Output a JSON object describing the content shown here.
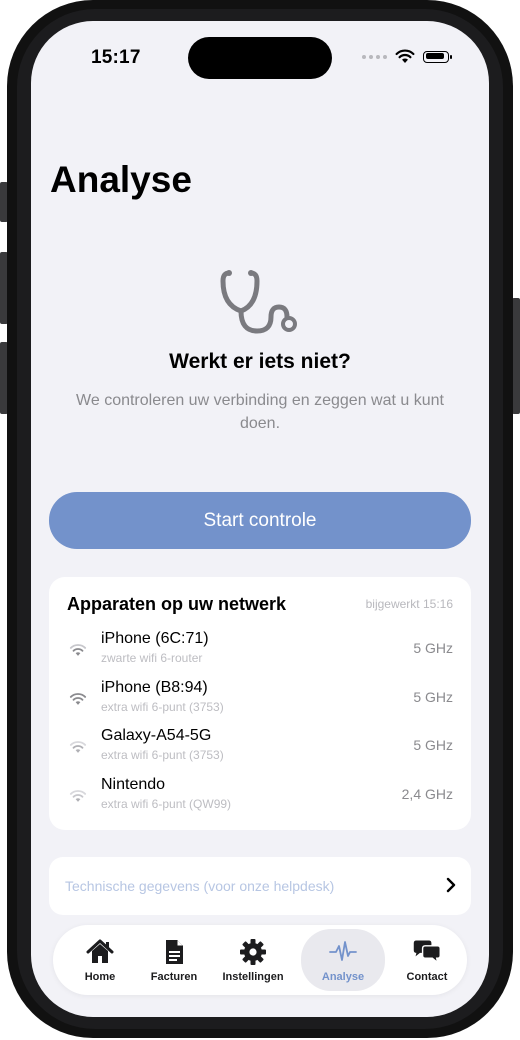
{
  "status": {
    "time": "15:17"
  },
  "page": {
    "title": "Analyse"
  },
  "hero": {
    "title": "Werkt er iets niet?",
    "subtitle": "We controleren uw verbinding en zeggen wat u kunt doen.",
    "button_label": "Start controle"
  },
  "devices": {
    "title": "Apparaten op uw netwerk",
    "updated": "bijgewerkt 15:16",
    "items": [
      {
        "name": "iPhone (6C:71)",
        "via": "zwarte wifi 6-router",
        "band": "5 GHz"
      },
      {
        "name": "iPhone (B8:94)",
        "via": "extra wifi 6-punt (3753)",
        "band": "5 GHz"
      },
      {
        "name": "Galaxy-A54-5G",
        "via": "extra wifi 6-punt (3753)",
        "band": "5 GHz"
      },
      {
        "name": "Nintendo",
        "via": "extra wifi 6-punt (QW99)",
        "band": "2,4 GHz"
      }
    ]
  },
  "tech": {
    "label": "Technische gegevens (voor onze helpdesk)"
  },
  "tabbar": {
    "active": "Analyse",
    "accent": "#7392cb",
    "items": [
      {
        "label": "Home",
        "icon": "house-icon"
      },
      {
        "label": "Facturen",
        "icon": "document-icon"
      },
      {
        "label": "Instellingen",
        "icon": "gear-icon"
      },
      {
        "label": "Analyse",
        "icon": "waveform-icon"
      },
      {
        "label": "Contact",
        "icon": "chat-bubbles-icon"
      }
    ]
  }
}
